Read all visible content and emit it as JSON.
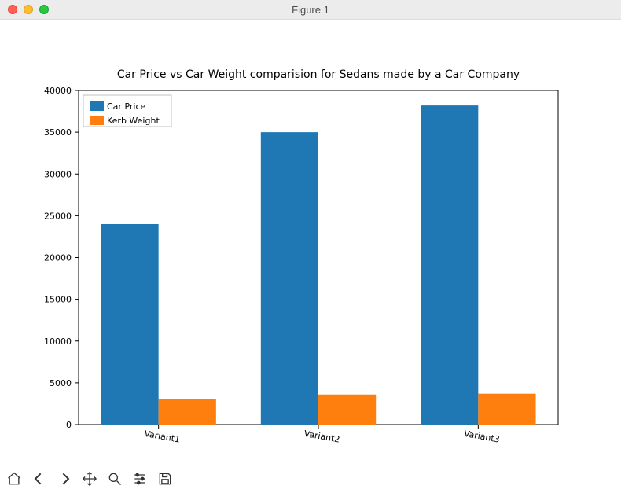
{
  "window": {
    "title": "Figure 1"
  },
  "chart_data": {
    "type": "bar",
    "title": "Car Price vs Car Weight comparision for Sedans made by a Car Company",
    "categories": [
      "Variant1",
      "Variant2",
      "Variant3"
    ],
    "series": [
      {
        "name": "Car Price",
        "values": [
          24000,
          35000,
          38200
        ],
        "color": "#1f77b4"
      },
      {
        "name": "Kerb Weight",
        "values": [
          3100,
          3600,
          3700
        ],
        "color": "#ff7f0e"
      }
    ],
    "ylim": [
      0,
      40000
    ],
    "yticks": [
      0,
      5000,
      10000,
      15000,
      20000,
      25000,
      30000,
      35000,
      40000
    ],
    "xlabel": "",
    "ylabel": ""
  },
  "toolbar": {
    "home": "Home",
    "back": "Back",
    "forward": "Forward",
    "pan": "Pan",
    "zoom": "Zoom",
    "config": "Configure subplots",
    "save": "Save"
  }
}
